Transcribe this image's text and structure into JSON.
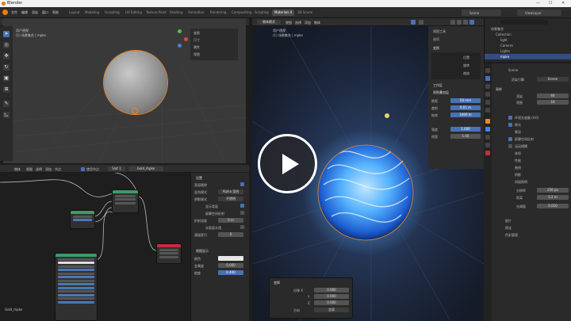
{
  "window": {
    "title": "Blender",
    "minimize": "—",
    "maximize": "☐",
    "close": "✕"
  },
  "menu": [
    "文件",
    "编辑",
    "渲染",
    "窗口",
    "帮助"
  ],
  "workspace_tabs": [
    "Layout",
    "Modeling",
    "Sculpting",
    "UV Editing",
    "Texture Paint",
    "Shading",
    "Animation",
    "Rendering",
    "Compositing",
    "Scripting",
    "Geometry Nodes",
    "Materials 4",
    "3D Scene"
  ],
  "active_workspace": "Materials 4",
  "scene": {
    "label": "Scene",
    "view_layer": "ViewLayer"
  },
  "viewport_left": {
    "mode": "物体模式",
    "header_menus": [
      "视图",
      "选择",
      "添加",
      "物体"
    ],
    "info_line1": "用户透视",
    "info_line2": "(1) 场景集合 | mpke",
    "n_panel": [
      "变换",
      "尺寸",
      "属性",
      "视图"
    ]
  },
  "node_editor": {
    "header_menus": [
      "物体",
      "视图",
      "选择",
      "添加",
      "节点"
    ],
    "use_nodes": "使用节点",
    "slot": "Slot 1",
    "material": "Gold_mpke",
    "footer": "Gold_mpke",
    "nodes": [
      {
        "name": "Principled BSDF",
        "color": "#3f9a6a"
      },
      {
        "name": "Texture Coordinate",
        "color": "#3f9a6a"
      },
      {
        "name": "Material Output",
        "color": "#c0303a"
      },
      {
        "name": "Gradient",
        "color": "#3f9a6a"
      }
    ]
  },
  "node_props": {
    "section": "设置",
    "rows": [
      {
        "label": "背面剔除",
        "value": ""
      },
      {
        "label": "混合模式",
        "value": "Alpha 混合"
      },
      {
        "label": "阴影模式",
        "value": "不透明"
      },
      {
        "label": "显示背面",
        "value": ""
      },
      {
        "label": "屏幕空间折射",
        "value": ""
      },
      {
        "label": "折射深度",
        "value": "0 m"
      },
      {
        "label": "次表面半透",
        "value": ""
      },
      {
        "label": "通道索引",
        "value": "0"
      }
    ],
    "section2": "视图显示",
    "rows2": [
      {
        "label": "颜色",
        "value": ""
      },
      {
        "label": "金属度",
        "value": "0.000"
      },
      {
        "label": "糙度",
        "value": "0.400"
      }
    ]
  },
  "viewport_right": {
    "mode": "物体模式",
    "header_menus": [
      "视图",
      "选择",
      "添加",
      "物体"
    ],
    "info_line1": "用户透视",
    "info_line2": "(1) 场景集合 | mpke"
  },
  "render_panel": {
    "tabs": [
      "视图工具",
      "选项"
    ],
    "section1": "变换",
    "rows1": [
      "位置",
      "旋转",
      "缩放"
    ],
    "section2": "工作区",
    "section3": "视图叠加层",
    "rows3": [
      {
        "label": "焦距",
        "value": "50 mm"
      },
      {
        "label": "裁剪",
        "value": "0.01 m"
      },
      {
        "label": "结束",
        "value": "1000 m"
      },
      {
        "label": "强度",
        "value": "1.000"
      },
      {
        "label": "线宽",
        "value": "1.00"
      }
    ]
  },
  "redo_panel": {
    "title": "变换",
    "rows": [
      {
        "label": "位移 X",
        "value": "0.000"
      },
      {
        "label": "Y",
        "value": "0.000"
      },
      {
        "label": "Z",
        "value": "0.000"
      },
      {
        "label": "方向",
        "value": "全局"
      }
    ]
  },
  "outliner": {
    "search": "",
    "items": [
      "场景集合",
      "Collection",
      "light",
      "Camera",
      "Lights",
      "mpke"
    ]
  },
  "properties": {
    "scene_label": "Scene",
    "engine_label": "渲染引擎",
    "engine": "Eevee",
    "sections": [
      "采样",
      "渲染",
      "视图",
      "环境光遮蔽 (AO)",
      "辉光",
      "景深",
      "屏幕空间反射",
      "运动模糊",
      "体积",
      "性能",
      "曲线",
      "阴影",
      "间接照明",
      "胶片",
      "简化",
      "色彩管理"
    ],
    "fields": [
      {
        "label": "渲染",
        "value": "64"
      },
      {
        "label": "视图",
        "value": "16"
      },
      {
        "label": "分辨率",
        "value": "256 px"
      },
      {
        "label": "距离",
        "value": "0.2 m"
      },
      {
        "label": "软阴影",
        "value": ""
      },
      {
        "label": "光阈值",
        "value": "0.010"
      }
    ]
  },
  "colors": {
    "accent": "#4772b3",
    "sphere_glow": "#57b3ff",
    "selection": "#e8882a"
  },
  "media": {
    "play_icon": "play-icon"
  }
}
